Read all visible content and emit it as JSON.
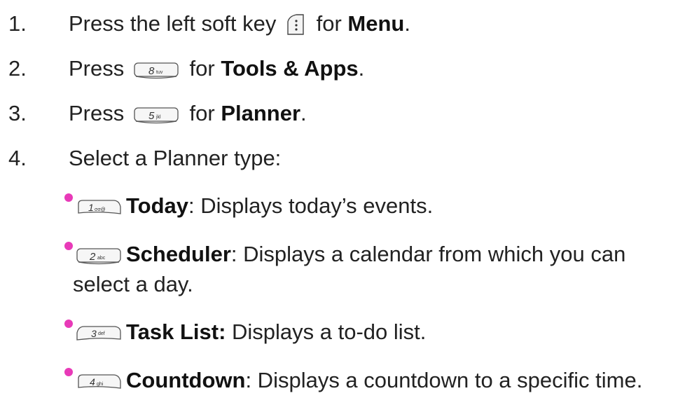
{
  "steps": [
    {
      "num": "1.",
      "pre": "Press the left soft key",
      "mid": "for",
      "bold": "Menu",
      "post": ".",
      "icon": "left-soft-key-icon"
    },
    {
      "num": "2.",
      "pre": "Press",
      "mid": "for",
      "bold": "Tools & Apps",
      "post": ".",
      "icon": "key-8-tuv-icon",
      "key_label": "8",
      "key_sub": "tuv"
    },
    {
      "num": "3.",
      "pre": "Press",
      "mid": "for",
      "bold": "Planner",
      "post": ".",
      "icon": "key-5-jkl-icon",
      "key_label": "5",
      "key_sub": "jkl"
    },
    {
      "num": "4.",
      "text": "Select a Planner type:"
    }
  ],
  "bullets": [
    {
      "bold": "Today",
      "desc": ": Displays today’s events.",
      "icon": "key-1-icon",
      "key_label": "1",
      "key_sub": "σσ@"
    },
    {
      "bold": "Scheduler",
      "desc": ": Displays a calendar from which you can",
      "desc2": "select a day.",
      "icon": "key-2-abc-icon",
      "key_label": "2",
      "key_sub": "abc"
    },
    {
      "bold": "Task List:",
      "desc": " Displays a to-do list.",
      "icon": "key-3-def-icon",
      "key_label": "3",
      "key_sub": "def"
    },
    {
      "bold": "Countdown",
      "desc": ": Displays a countdown to a specific time.",
      "icon": "key-4-ghi-icon",
      "key_label": "4",
      "key_sub": "ghi"
    }
  ],
  "colors": {
    "bullet": "#e83ab8",
    "text": "#222222"
  }
}
